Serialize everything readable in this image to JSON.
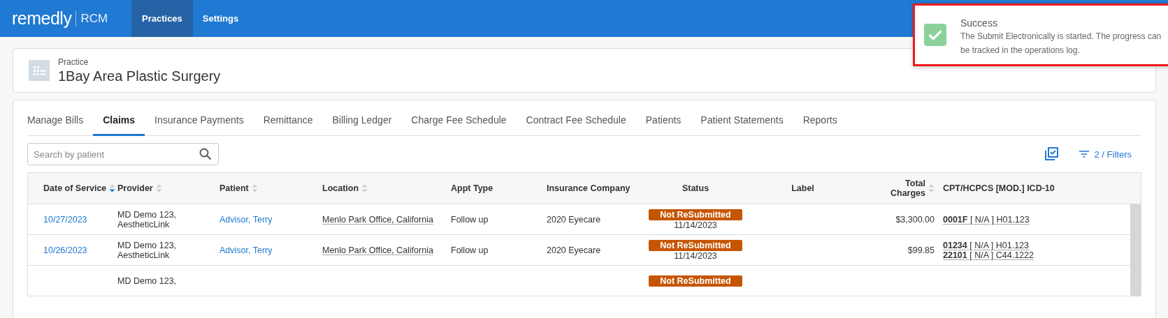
{
  "app": {
    "logo": "remedly",
    "logo_suffix": "RCM"
  },
  "nav": [
    {
      "label": "Practices",
      "selected": true
    },
    {
      "label": "Settings",
      "selected": false
    }
  ],
  "toast": {
    "title": "Success",
    "message": "The Submit Electronically is started. The progress can be tracked in the operations log."
  },
  "practice": {
    "caption": "Practice",
    "name": "1Bay Area Plastic Surgery"
  },
  "tabs": [
    {
      "label": "Manage Bills",
      "selected": false
    },
    {
      "label": "Claims",
      "selected": true
    },
    {
      "label": "Insurance Payments",
      "selected": false
    },
    {
      "label": "Remittance",
      "selected": false
    },
    {
      "label": "Billing Ledger",
      "selected": false
    },
    {
      "label": "Charge Fee Schedule",
      "selected": false
    },
    {
      "label": "Contract Fee Schedule",
      "selected": false
    },
    {
      "label": "Patients",
      "selected": false
    },
    {
      "label": "Patient Statements",
      "selected": false
    },
    {
      "label": "Reports",
      "selected": false
    }
  ],
  "search": {
    "placeholder": "Search by patient"
  },
  "filters": {
    "label": "2 / Filters"
  },
  "table": {
    "columns": [
      {
        "label": "Date of Service",
        "sorted": true
      },
      {
        "label": "Provider",
        "sorted": false
      },
      {
        "label": "Patient",
        "sorted": false
      },
      {
        "label": "Location",
        "sorted": false
      },
      {
        "label": "Appt Type"
      },
      {
        "label": "Insurance Company"
      },
      {
        "label": "Status"
      },
      {
        "label": "Label"
      },
      {
        "label": "Total Charges",
        "sorted": false
      },
      {
        "label": "CPT/HCPCS [MOD.] ICD-10"
      }
    ],
    "rows": [
      {
        "date": "10/27/2023",
        "provider": [
          "MD Demo 123,",
          "AestheticLink"
        ],
        "patient": "Advisor, Terry",
        "location": "Menlo Park Office, California",
        "appt_type": "Follow up",
        "insurance": "2020 Eyecare",
        "status": "Not ReSubmitted",
        "status_date": "11/14/2023",
        "total": "$3,300.00",
        "codes": [
          "**0001F** [ N/A ] H01.123"
        ]
      },
      {
        "date": "10/26/2023",
        "provider": [
          "MD Demo 123,",
          "AestheticLink"
        ],
        "patient": "Advisor, Terry",
        "location": "Menlo Park Office, California",
        "appt_type": "Follow up",
        "insurance": "2020 Eyecare",
        "status": "Not ReSubmitted",
        "status_date": "11/14/2023",
        "total": "$99.85",
        "codes": [
          "**01234** [ N/A ] H01.123",
          "**22101** [ N/A ] C44.1222"
        ]
      },
      {
        "provider": [
          "MD Demo 123,"
        ],
        "status": "Not ReSubmitted"
      }
    ]
  }
}
